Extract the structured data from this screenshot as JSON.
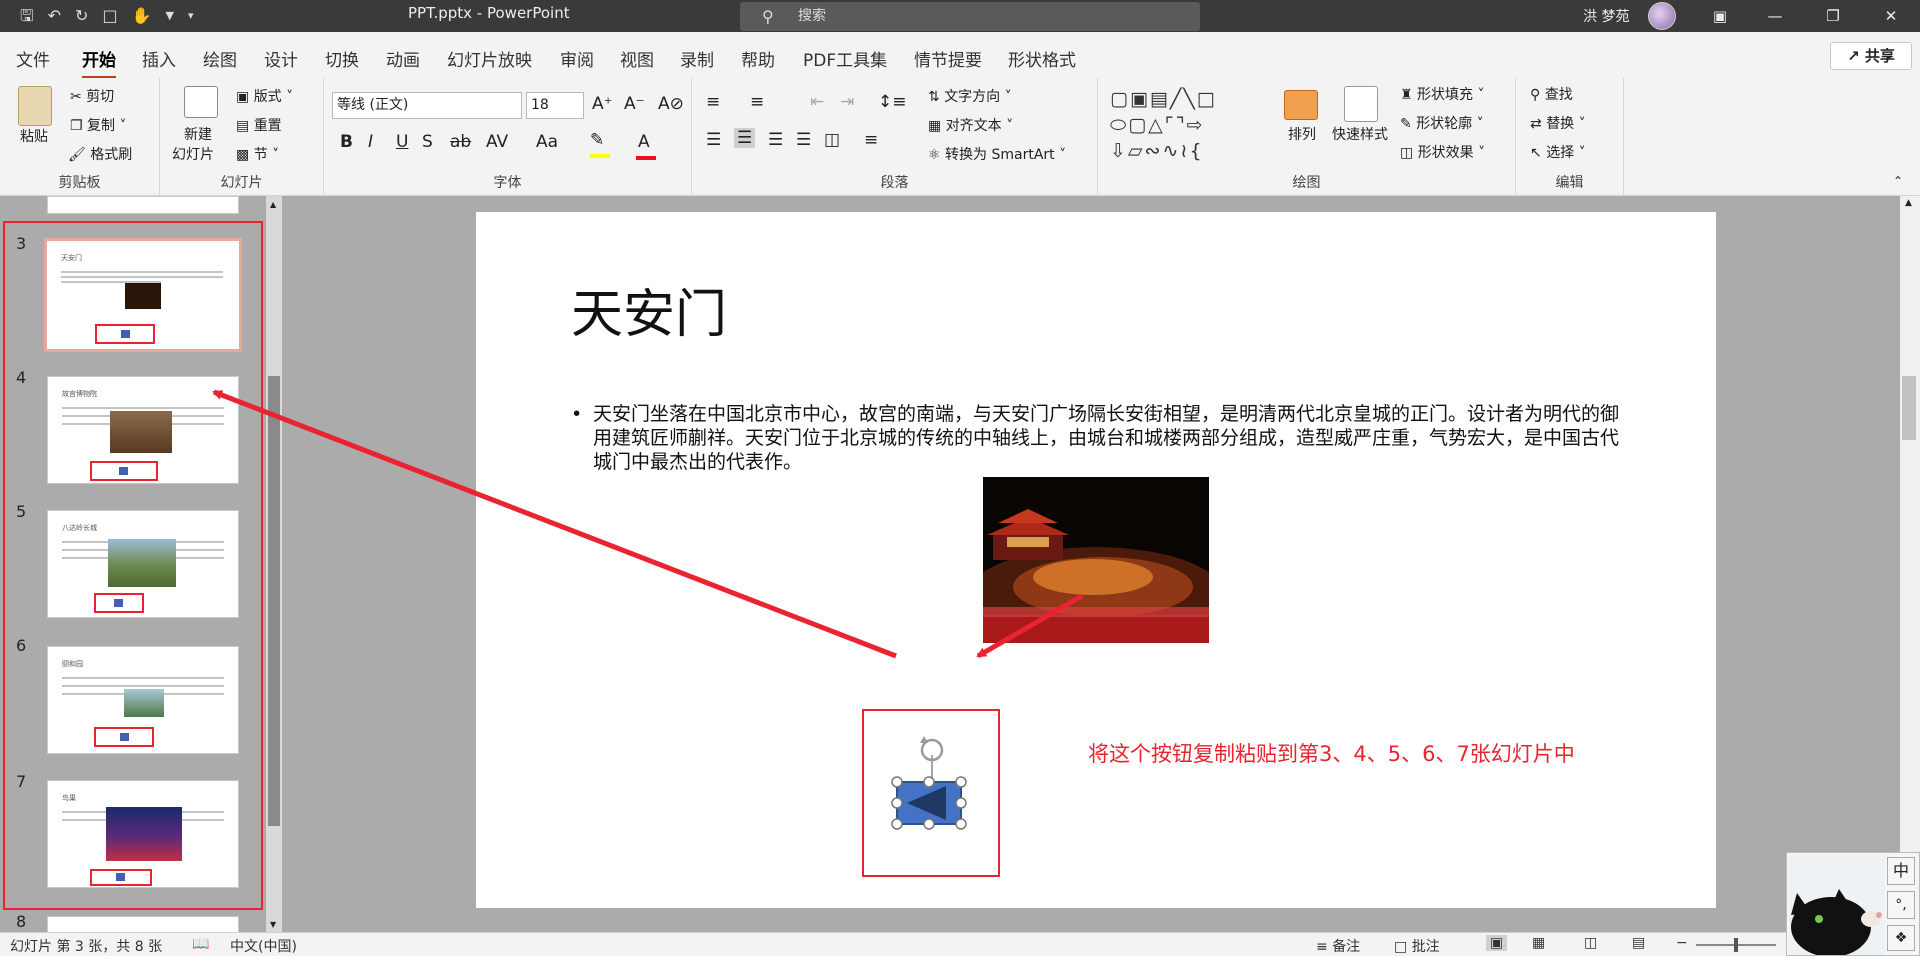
{
  "titlebar": {
    "doc_title": "PPT.pptx  -  PowerPoint",
    "search_placeholder": "搜索",
    "user_name": "洪 梦苑",
    "qat_icons": [
      "save-icon",
      "undo-icon",
      "redo-icon",
      "present-icon",
      "touch-icon"
    ],
    "window_controls": [
      "ribbon-display-icon",
      "minimize-icon",
      "restore-icon",
      "close-icon"
    ]
  },
  "menu": {
    "tabs": [
      "文件",
      "开始",
      "插入",
      "绘图",
      "设计",
      "切换",
      "动画",
      "幻灯片放映",
      "审阅",
      "视图",
      "录制",
      "帮助",
      "PDF工具集",
      "情节提要",
      "形状格式"
    ],
    "active": "开始",
    "share": "共享"
  },
  "ribbon": {
    "clipboard": {
      "paste": "粘贴",
      "cut": "剪切",
      "copy": "复制",
      "format_painter": "格式刷",
      "label": "剪贴板"
    },
    "slides": {
      "new_slide": "新建",
      "new_slide2": "幻灯片",
      "layout": "版式",
      "reset": "重置",
      "section": "节",
      "label": "幻灯片"
    },
    "font": {
      "font_name": "等线 (正文)",
      "font_size": "18",
      "label": "字体",
      "buttons": [
        "B",
        "I",
        "U",
        "S",
        "ab",
        "AV",
        "Aa"
      ]
    },
    "paragraph": {
      "text_direction": "文字方向",
      "align_text": "对齐文本",
      "smartart": "转换为 SmartArt",
      "label": "段落"
    },
    "drawing": {
      "arrange": "排列",
      "quick_styles": "快速样式",
      "shape_fill": "形状填充",
      "shape_outline": "形状轮廓",
      "shape_effects": "形状效果",
      "label": "绘图"
    },
    "editing": {
      "find": "查找",
      "replace": "替换",
      "select": "选择",
      "label": "编辑"
    }
  },
  "thumbnails": [
    {
      "num": "3",
      "title": "天安门"
    },
    {
      "num": "4",
      "title": "故宫博物院"
    },
    {
      "num": "5",
      "title": "八达岭长城"
    },
    {
      "num": "6",
      "title": "颐和园"
    },
    {
      "num": "7",
      "title": "鸟巢"
    },
    {
      "num": "8",
      "title": ""
    }
  ],
  "slide": {
    "title": "天安门",
    "bullet": "天安门坐落在中国北京市中心，故宫的南端，与天安门广场隔长安街相望，是明清两代北京皇城的正门。设计者为明代的御用建筑匠师蒯祥。天安门位于北京城的传统的中轴线上，由城台和城楼两部分组成，造型威严庄重，气势宏大，是中国古代城门中最杰出的代表作。",
    "annotation": "将这个按钮复制粘贴到第3、4、5、6、7张幻灯片中"
  },
  "status": {
    "slide_info": "幻灯片 第 3 张，共 8 张",
    "language": "中文(中国)",
    "notes": "备注",
    "comments": "批注"
  },
  "ime": {
    "mode": "中",
    "punct": "°,"
  },
  "colors": {
    "accent": "#c43e1c",
    "annotation_red": "#ea2330",
    "button_blue": "#4472c4"
  }
}
